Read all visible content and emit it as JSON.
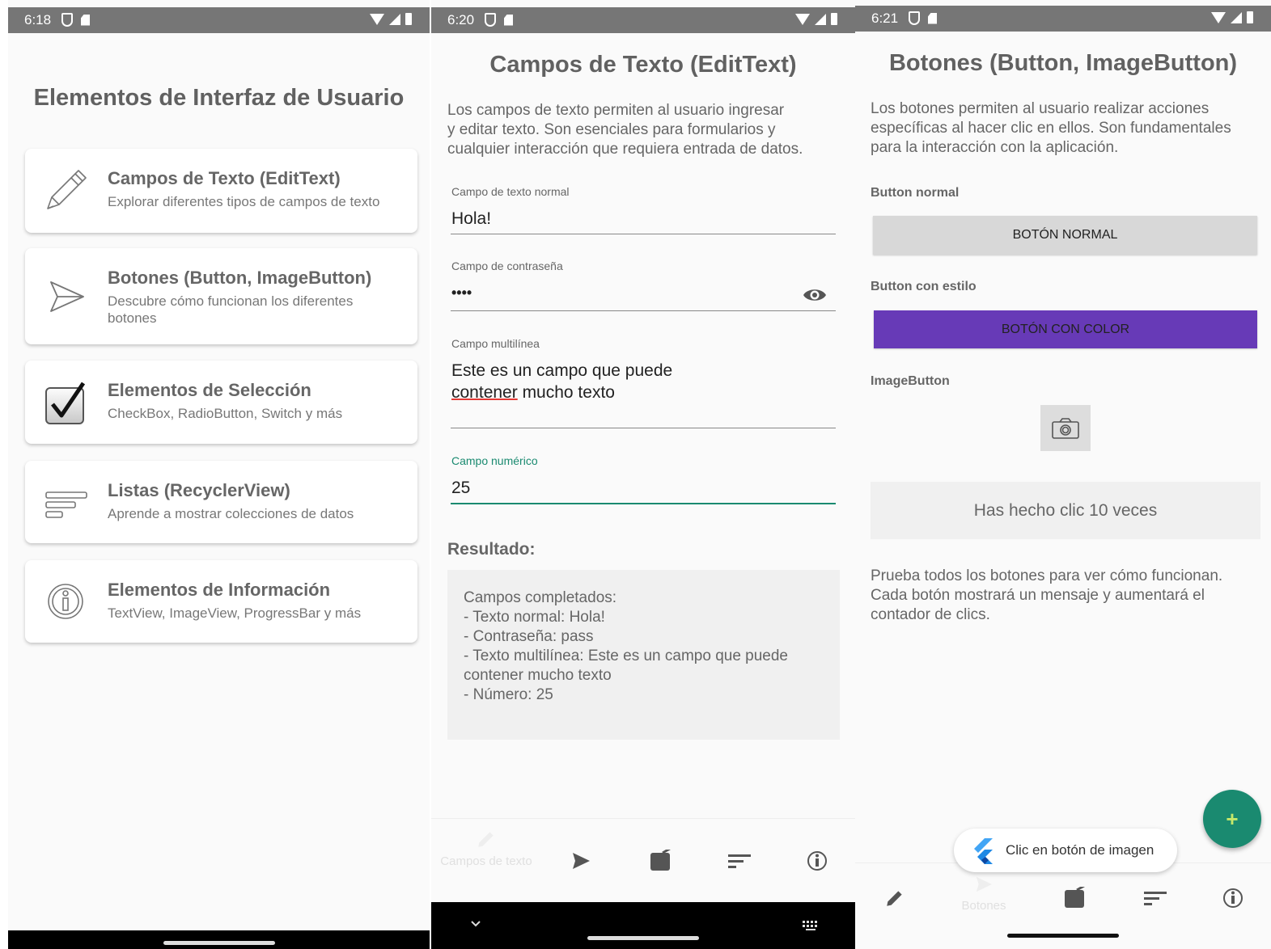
{
  "screen1": {
    "status": {
      "time": "6:18"
    },
    "title": "Elementos de Interfaz de Usuario",
    "cards": [
      {
        "title": "Campos de Texto (EditText)",
        "subtitle": "Explorar diferentes tipos de campos de texto",
        "icon": "pencil-icon"
      },
      {
        "title": "Botones (Button, ImageButton)",
        "subtitle": "Descubre cómo funcionan los diferentes botones",
        "icon": "send-icon"
      },
      {
        "title": "Elementos de Selección",
        "subtitle": "CheckBox, RadioButton, Switch y más",
        "icon": "checkbox-icon"
      },
      {
        "title": "Listas (RecyclerView)",
        "subtitle": "Aprende a mostrar colecciones de datos",
        "icon": "list-icon"
      },
      {
        "title": "Elementos de Información",
        "subtitle": "TextView, ImageView, ProgressBar y más",
        "icon": "info-icon"
      }
    ]
  },
  "screen2": {
    "status": {
      "time": "6:20"
    },
    "title": "Campos de Texto (EditText)",
    "description": [
      "Los campos de texto permiten al usuario ingresar",
      "y editar texto. Son esenciales para formularios y",
      "cualquier interacción que requiera entrada de datos."
    ],
    "fields": {
      "normal": {
        "label": "Campo de texto normal",
        "value": "Hola!"
      },
      "password": {
        "label": "Campo de contraseña",
        "value": "••••"
      },
      "multiline": {
        "label": "Campo multilínea",
        "line1": "Este es un campo que puede",
        "line2_word": "contener",
        "line2_rest": " mucho texto"
      },
      "numeric": {
        "label": "Campo numérico",
        "value": "25"
      }
    },
    "result": {
      "title": "Resultado:",
      "lines": [
        "Campos completados:",
        "- Texto normal: Hola!",
        "- Contraseña: pass",
        "- Texto multilínea: Este es un campo que puede",
        "contener mucho texto",
        "- Número: 25"
      ]
    },
    "bottom_nav": {
      "active_label": "Campos de texto"
    }
  },
  "screen3": {
    "status": {
      "time": "6:21"
    },
    "title": "Botones (Button, ImageButton)",
    "description": [
      "Los botones permiten al usuario realizar acciones",
      "específicas al hacer clic en ellos. Son fundamentales",
      "para la interacción con la aplicación."
    ],
    "button_normal_label": "Button normal",
    "button_normal_text": "BOTÓN NORMAL",
    "button_style_label": "Button con estilo",
    "button_style_text": "BOTÓN CON COLOR",
    "imagebutton_label": "ImageButton",
    "counter": "Has hecho clic 10 veces",
    "footer": [
      "Prueba todos los botones para ver cómo funcionan.",
      "Cada botón mostrará un mensaje y aumentará el",
      "contador de clics."
    ],
    "fab_symbol": "+",
    "toast": "Clic en botón de imagen",
    "bottom_nav": {
      "active_label": "Botones"
    }
  },
  "colors": {
    "accent": "#1a8a70",
    "purple_button": "#673ab7",
    "status_bar": "#767676"
  }
}
